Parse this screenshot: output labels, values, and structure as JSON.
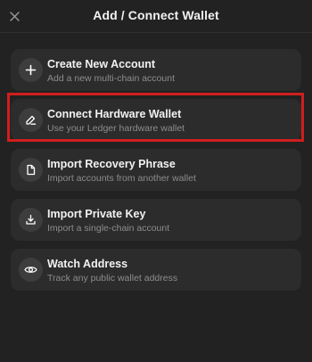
{
  "header": {
    "title": "Add / Connect Wallet",
    "close_icon": "close-icon"
  },
  "options": [
    {
      "id": "create",
      "icon": "plus-icon",
      "label": "Create New Account",
      "description": "Add a new multi-chain account"
    },
    {
      "id": "hardware",
      "icon": "pen-icon",
      "label": "Connect Hardware Wallet",
      "description": "Use your Ledger hardware wallet"
    },
    {
      "id": "recovery",
      "icon": "document-icon",
      "label": "Import Recovery Phrase",
      "description": "Import accounts from another wallet"
    },
    {
      "id": "private-key",
      "icon": "download-icon",
      "label": "Import Private Key",
      "description": "Import a single-chain account"
    },
    {
      "id": "watch",
      "icon": "eye-icon",
      "label": "Watch Address",
      "description": "Track any public wallet address"
    }
  ],
  "colors": {
    "background": "#222222",
    "card": "#2c2c2c",
    "highlight": "#d01e1e"
  }
}
